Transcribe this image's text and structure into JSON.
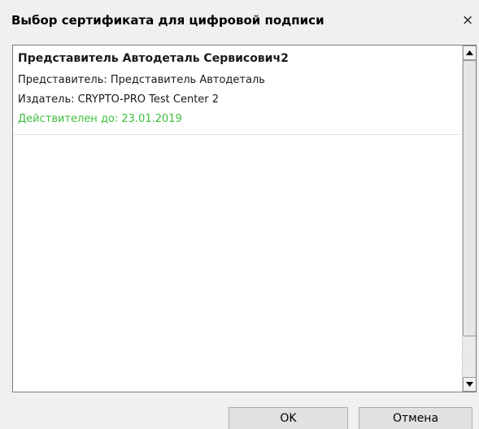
{
  "dialog": {
    "title": "Выбор сертификата для цифровой подписи",
    "close_glyph": "×"
  },
  "certificates": [
    {
      "name": "Представитель Автодеталь Сервисович2",
      "subject": "Представитель: Представитель Автодеталь",
      "issuer": "Издатель: CRYPTO-PRO Test Center 2",
      "valid_until": "Действителен до: 23.01.2019",
      "valid_color": "#3bbf3b"
    }
  ],
  "buttons": {
    "ok_label": "OK",
    "cancel_label": "Отмена"
  }
}
